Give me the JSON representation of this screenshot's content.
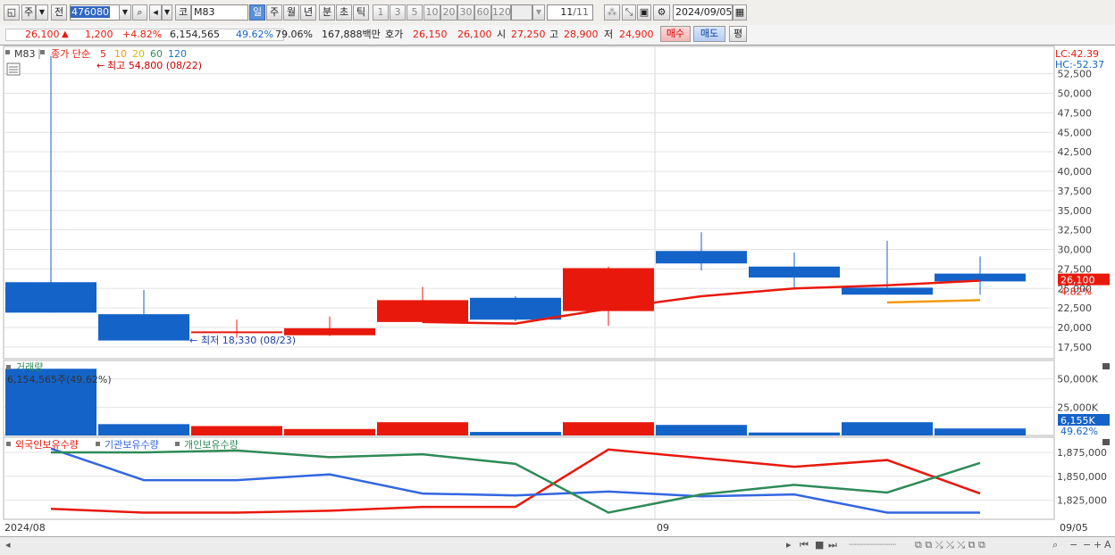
{
  "toolbar": {
    "mode_label": "주",
    "prev_label": "전",
    "code_value": "476080",
    "code_prefix": "코",
    "name_value": "M83",
    "periods": [
      "일",
      "주",
      "월",
      "년",
      "분",
      "초",
      "틱"
    ],
    "selected_period": "일",
    "intervals": [
      "1",
      "3",
      "5",
      "10",
      "20",
      "30",
      "60",
      "120"
    ],
    "count_value": "11",
    "count_total": "/11",
    "date_value": "2024/09/05"
  },
  "quote": {
    "price": "26,100",
    "change": "1,200",
    "change_pct": "+4.82%",
    "volume": "6,154,565",
    "volume_ratio": "49.62%",
    "turnover_pct": "79.06%",
    "amount": "167,888백만",
    "bid_label": "호가",
    "ask": "26,150",
    "bid": "26,100",
    "open_label": "시",
    "open": "27,250",
    "high_label": "고",
    "high": "28,900",
    "low_label": "저",
    "low": "24,900",
    "buy_label": "매수",
    "sell_label": "매도",
    "eval_label": "평"
  },
  "colors": {
    "up": "#e8190c",
    "down": "#1463c8",
    "ma5": "#e8190c",
    "ma10": "#f29a0b",
    "ma20": "#c9c100",
    "ma60": "#2e8b57",
    "ma120": "#1a75c8",
    "foreign": "#e8190c",
    "institution": "#3366e0",
    "individual": "#2e8b57"
  },
  "price_panel": {
    "series_label": "M83",
    "legend_title": "종가 단순",
    "ma_periods": [
      "5",
      "10",
      "20",
      "60",
      "120"
    ],
    "high_annotation": "최고 54,800 (08/22)",
    "low_annotation": "최저 18,330 (08/23)",
    "lc": "LC:42.39",
    "hc": "HC:-52.37",
    "current_price": "26,100",
    "current_pct": "4.82%"
  },
  "volume_panel": {
    "title": "거래량",
    "current_label": "6,154,565주(49.62%)",
    "current_short": "6,155K",
    "current_pct": "49.62%"
  },
  "holdings_panel": {
    "legend": [
      "외국인보유수량",
      "기관보유수량",
      "개인보유수량"
    ]
  },
  "x_axis": {
    "left_label": "2024/08",
    "mid_label": "09",
    "right_label": "09/05"
  },
  "chart_data": [
    {
      "type": "candlestick",
      "ylim": [
        16000,
        56000
      ],
      "yticks": [
        17500,
        20000,
        22500,
        25000,
        27500,
        30000,
        32500,
        35000,
        37500,
        40000,
        42500,
        45000,
        47500,
        50000,
        52500
      ],
      "ytick_labels": [
        "17,500",
        "20,000",
        "22,500",
        "25,000",
        "27,500",
        "30,000",
        "32,500",
        "35,000",
        "37,500",
        "40,000",
        "42,500",
        "45,000",
        "47,500",
        "50,000",
        "52,500"
      ],
      "candles": [
        {
          "open": 25800,
          "high": 54800,
          "low": 21900,
          "close": 21900
        },
        {
          "open": 21700,
          "high": 24800,
          "low": 18330,
          "close": 18330
        },
        {
          "open": 19300,
          "high": 21000,
          "low": 18700,
          "close": 19500
        },
        {
          "open": 19000,
          "high": 21400,
          "low": 18900,
          "close": 19900
        },
        {
          "open": 20700,
          "high": 25200,
          "low": 20600,
          "close": 23500
        },
        {
          "open": 23800,
          "high": 24000,
          "low": 20800,
          "close": 21000
        },
        {
          "open": 22100,
          "high": 27800,
          "low": 20200,
          "close": 27600
        },
        {
          "open": 29800,
          "high": 32200,
          "low": 27300,
          "close": 28200
        },
        {
          "open": 27800,
          "high": 29600,
          "low": 25100,
          "close": 26400
        },
        {
          "open": 25100,
          "high": 31100,
          "low": 24200,
          "close": 24200
        },
        {
          "open": 26900,
          "high": 29100,
          "low": 24200,
          "close": 25900
        }
      ],
      "ma5": [
        null,
        null,
        null,
        null,
        20700,
        20500,
        22400,
        24000,
        25000,
        25400,
        26000
      ],
      "ma10": [
        null,
        null,
        null,
        null,
        null,
        null,
        null,
        null,
        null,
        23200,
        23500
      ]
    },
    {
      "type": "bar",
      "title": "거래량",
      "ylim": [
        0,
        60000000
      ],
      "yticks": [
        25000000,
        50000000
      ],
      "ytick_labels": [
        "25,000K",
        "50,000K"
      ],
      "values": [
        59000000,
        10000000,
        8300000,
        5700000,
        11700000,
        3100000,
        11700000,
        9300000,
        2600000,
        11700000,
        6155000
      ],
      "directions": [
        "down",
        "down",
        "up",
        "up",
        "up",
        "down",
        "up",
        "down",
        "down",
        "down",
        "down"
      ]
    },
    {
      "type": "line",
      "ylim": [
        1805000,
        1889000
      ],
      "yticks": [
        1825000,
        1850000,
        1875000
      ],
      "ytick_labels": [
        "1,825,000",
        "1,850,000",
        "1,875,000"
      ],
      "series": [
        {
          "name": "외국인보유수량",
          "values": [
            1816000,
            1812000,
            1812000,
            1814000,
            1818000,
            1818000,
            1878000,
            1869000,
            1860000,
            1867000,
            1832000
          ]
        },
        {
          "name": "기관보유수량",
          "values": [
            1879000,
            1846000,
            1846000,
            1852000,
            1832000,
            1830000,
            1834000,
            1829000,
            1831000,
            1812000,
            1812000
          ]
        },
        {
          "name": "개인보유수량",
          "values": [
            1875000,
            1875000,
            1877000,
            1870000,
            1873000,
            1863000,
            1812000,
            1831000,
            1841000,
            1833000,
            1864000
          ]
        }
      ]
    }
  ]
}
